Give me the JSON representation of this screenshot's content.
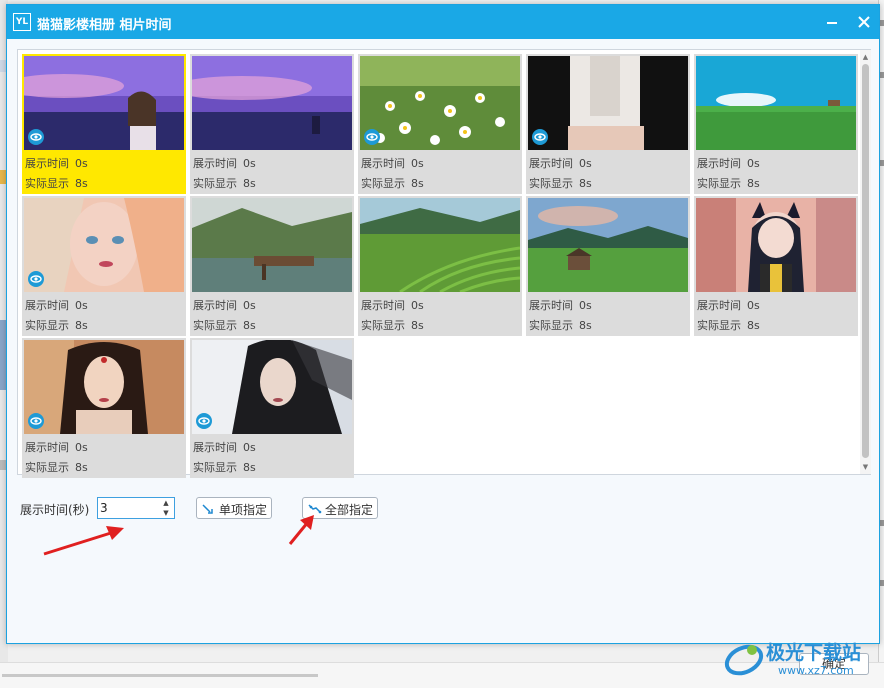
{
  "window": {
    "app_logo": "YL",
    "title": "猫猫影楼相册 相片时间",
    "minimize_icon": "minimize-icon",
    "close_icon": "close-icon"
  },
  "photos": [
    {
      "show_label": "展示时间",
      "show_value": "0s",
      "actual_label": "实际显示",
      "actual_value": "8s",
      "selected": true,
      "eye": true
    },
    {
      "show_label": "展示时间",
      "show_value": "0s",
      "actual_label": "实际显示",
      "actual_value": "8s",
      "selected": false,
      "eye": false
    },
    {
      "show_label": "展示时间",
      "show_value": "0s",
      "actual_label": "实际显示",
      "actual_value": "8s",
      "selected": false,
      "eye": true
    },
    {
      "show_label": "展示时间",
      "show_value": "0s",
      "actual_label": "实际显示",
      "actual_value": "8s",
      "selected": false,
      "eye": true
    },
    {
      "show_label": "展示时间",
      "show_value": "0s",
      "actual_label": "实际显示",
      "actual_value": "8s",
      "selected": false,
      "eye": false
    },
    {
      "show_label": "展示时间",
      "show_value": "0s",
      "actual_label": "实际显示",
      "actual_value": "8s",
      "selected": false,
      "eye": true
    },
    {
      "show_label": "展示时间",
      "show_value": "0s",
      "actual_label": "实际显示",
      "actual_value": "8s",
      "selected": false,
      "eye": false
    },
    {
      "show_label": "展示时间",
      "show_value": "0s",
      "actual_label": "实际显示",
      "actual_value": "8s",
      "selected": false,
      "eye": false
    },
    {
      "show_label": "展示时间",
      "show_value": "0s",
      "actual_label": "实际显示",
      "actual_value": "8s",
      "selected": false,
      "eye": false
    },
    {
      "show_label": "展示时间",
      "show_value": "0s",
      "actual_label": "实际显示",
      "actual_value": "8s",
      "selected": false,
      "eye": false
    },
    {
      "show_label": "展示时间",
      "show_value": "0s",
      "actual_label": "实际显示",
      "actual_value": "8s",
      "selected": false,
      "eye": true
    },
    {
      "show_label": "展示时间",
      "show_value": "0s",
      "actual_label": "实际显示",
      "actual_value": "8s",
      "selected": false,
      "eye": true
    }
  ],
  "controls": {
    "duration_label": "展示时间(秒)",
    "duration_value": "3",
    "single_button": "单项指定",
    "all_button": "全部指定",
    "ok_button": "确定"
  },
  "watermark": {
    "name": "极光下载站",
    "url": "www.xz7.com"
  },
  "colors": {
    "titlebar": "#1aa8e6",
    "selected_tile": "#ffe800",
    "arrow": "#e02020"
  }
}
